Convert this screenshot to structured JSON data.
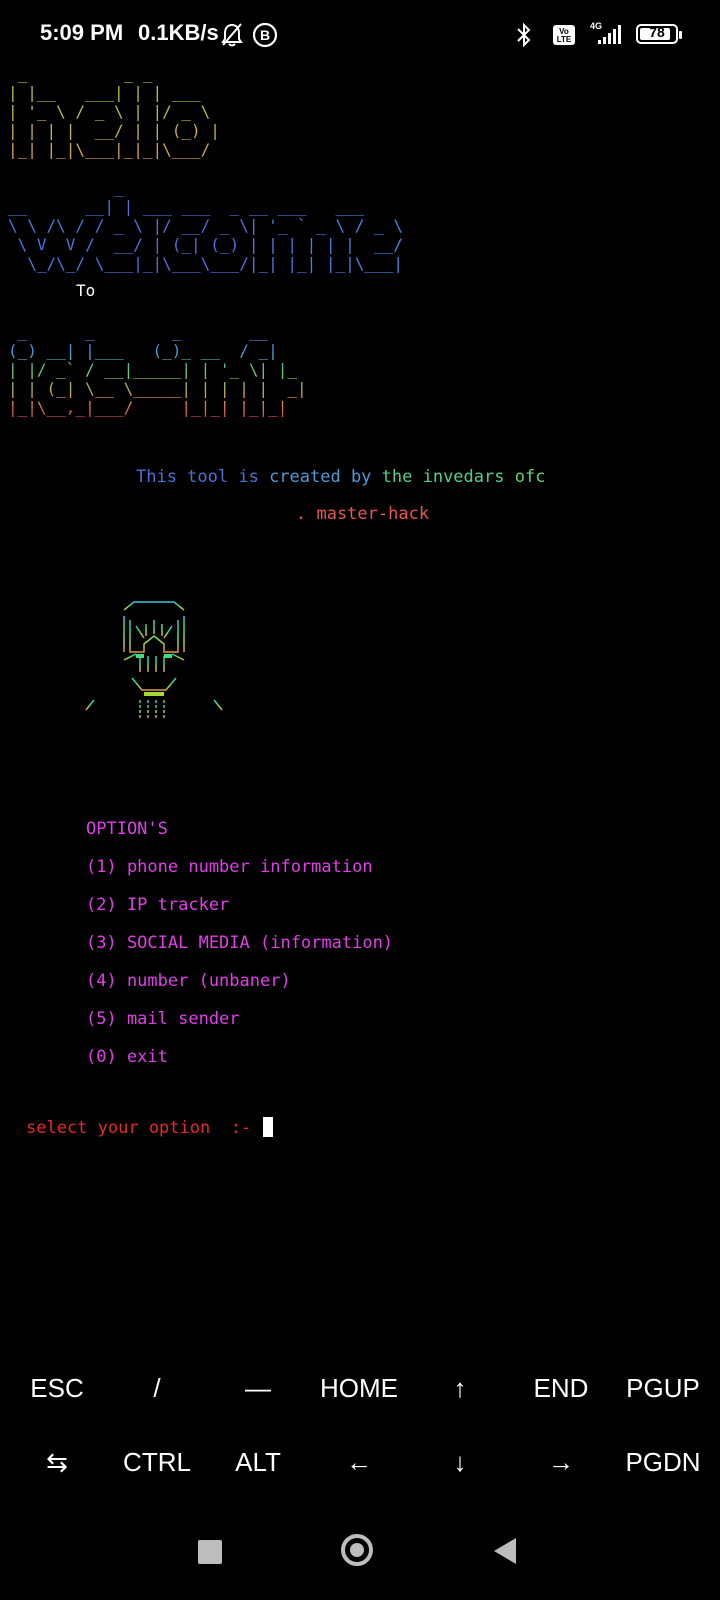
{
  "status_bar": {
    "time": "5:09 PM",
    "net_speed": "0.1KB/s",
    "icons": [
      "bell-off-icon",
      "b-circle-icon",
      "bluetooth-icon",
      "volte-icon",
      "signal-4g-icon",
      "battery-icon"
    ],
    "network_label": "4G",
    "volte_label": "Vo LTE",
    "battery_level": "78"
  },
  "terminal": {
    "banner_hello": " _          _ _       \n| |__   ___| | | ___  \n| '_ \\ / _ \\ | |/ _ \\ \n| | | |  __/ | | (_) |\n|_| |_|\\___|_|_|\\___/ ",
    "banner_welcome": "           _                          \n__      __| | ___ ___  _ __ ___   ___ \n\\ \\ /\\ / / _ \\ |/ __/ _ \\| '_ ` _ \\ / _ \\\n \\ V  V /  __/ | (_| (_) | | | | | |  __/\n  \\_/\\_/ \\___|_|\\___\\___/|_| |_| |_|\\___|",
    "to_label": "To",
    "banner_ctn": " _      _        _       __ \n(_) __| |___   (_)_ __  / _|\n| |/ _` / __|_____| | '_ \\| |_ \n| | (_| \\__ \\_____| | | | |  _|\n|_|\\__,_|___/     |_|_| |_|_|  ",
    "credit": {
      "part1": "This tool is",
      "part2": " created by",
      "part3": " the invedars",
      "part4": " ofc"
    },
    "master_hack": ". master-hack",
    "menu": {
      "title": "OPTION'S",
      "options": [
        "(1) phone number information",
        "(2) IP tracker",
        "(3) SOCIAL MEDIA (information)",
        "(4) number (unbaner)",
        "(5) mail sender",
        "(0) exit"
      ]
    },
    "prompt": "select your option  :- "
  },
  "extra_keys": {
    "row1": [
      "ESC",
      "/",
      "—",
      "HOME",
      "↑",
      "END",
      "PGUP"
    ],
    "row2": [
      "⇆",
      "CTRL",
      "ALT",
      "←",
      "↓",
      "→",
      "PGDN"
    ]
  },
  "nav_bar": {
    "icons": [
      "recents-square-icon",
      "home-circle-icon",
      "back-triangle-icon"
    ]
  },
  "colors": {
    "background": "#000000",
    "menu": "#e13ee8",
    "prompt": "#e8272b",
    "master_hack": "#e8564e"
  }
}
